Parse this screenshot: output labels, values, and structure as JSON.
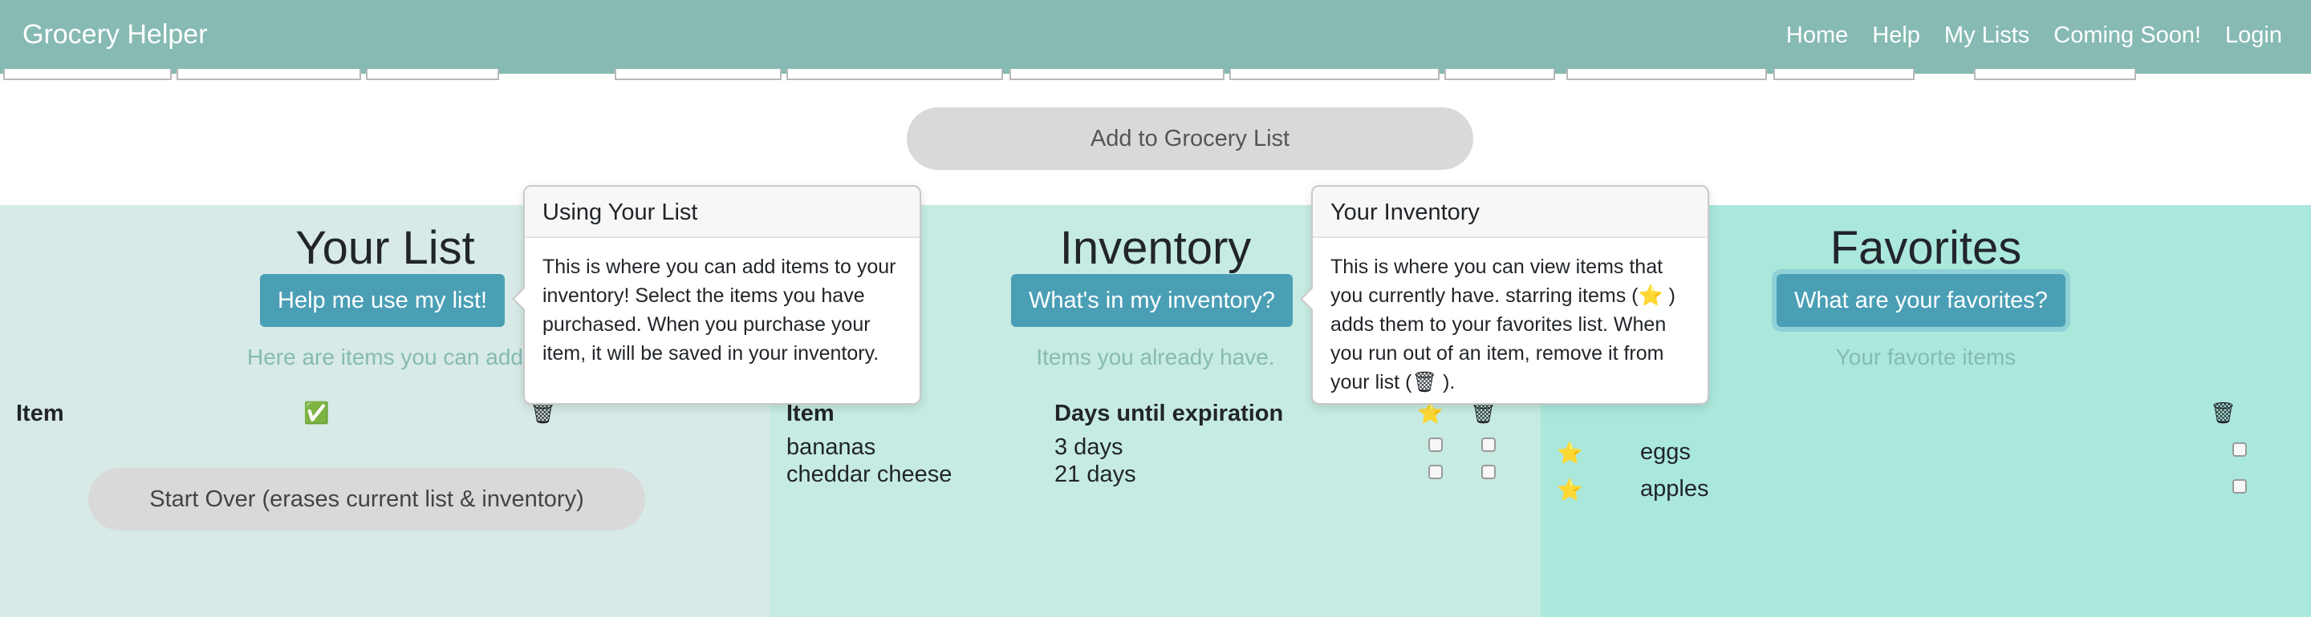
{
  "navbar": {
    "brand": "Grocery Helper",
    "links": [
      "Home",
      "Help",
      "My Lists",
      "Coming Soon!",
      "Login"
    ]
  },
  "add_button": "Add to Grocery List",
  "your_list": {
    "title": "Your List",
    "help_button": "Help me use my list!",
    "subtitle": "Here are items you can add",
    "header_item": "Item",
    "header_check_icon": "✅",
    "header_trash_icon": "🗑",
    "start_over_button": "Start Over (erases current list & inventory)"
  },
  "popover_list": {
    "title": "Using Your List",
    "body": "This is where you can add items to your inventory! Select the items you have purchased. When you purchase your item, it will be saved in your inventory."
  },
  "inventory": {
    "title": "Inventory",
    "help_button": "What's in my inventory?",
    "subtitle": "Items you already have.",
    "header_item": "Item",
    "header_days": "Days until expiration",
    "header_star_icon": "⭐",
    "header_trash_icon": "🗑",
    "rows": [
      {
        "item": "bananas",
        "days": "3 days"
      },
      {
        "item": "cheddar cheese",
        "days": "21 days"
      }
    ]
  },
  "popover_inventory": {
    "title": "Your Inventory",
    "body_1": "This is where you can view items that you currently have. starring items (",
    "star_icon": "⭐",
    "body_2": " ) adds them to your favorites list. When you run out of an item, remove it from your list (",
    "trash_icon": "🗑",
    "body_3": " )."
  },
  "favorites": {
    "title": "Favorites",
    "help_button": "What are your favorites?",
    "subtitle": "Your favorte items",
    "header_trash_icon": "🗑",
    "star_icon": "⭐",
    "rows": [
      {
        "item": "eggs"
      },
      {
        "item": "apples"
      }
    ]
  }
}
